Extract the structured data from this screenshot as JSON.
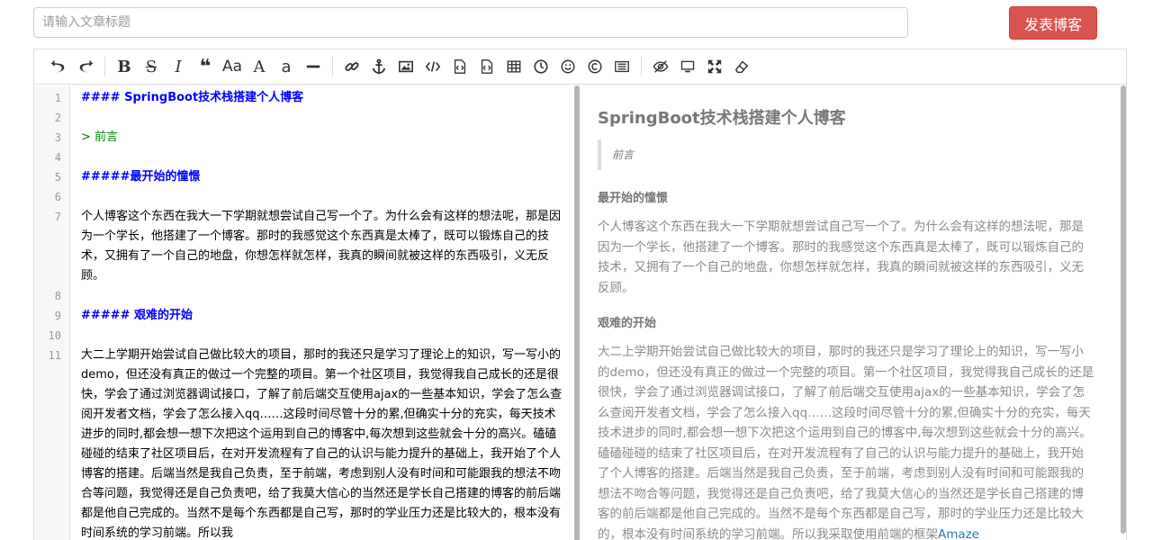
{
  "header": {
    "title_placeholder": "请输入文章标题",
    "publish_label": "发表博客",
    "publish_color": "#d9534f"
  },
  "toolbar": {
    "icons": [
      "undo-icon",
      "redo-icon",
      "bold-icon",
      "strikethrough-icon",
      "italic-icon",
      "quote-icon",
      "uppercase-icon",
      "font-size-large-icon",
      "font-size-small-icon",
      "horizontal-rule-icon",
      "link-icon",
      "anchor-icon",
      "image-icon",
      "code-icon",
      "code-block-icon",
      "preformatted-icon",
      "table-icon",
      "datetime-icon",
      "emoji-icon",
      "html-entities-icon",
      "pagebreak-icon",
      "toggle-preview-icon",
      "watch-icon",
      "fullscreen-icon",
      "clear-icon"
    ]
  },
  "code": {
    "lines": [
      {
        "n": "1",
        "text": "#### SpringBoot技术栈搭建个人博客"
      },
      {
        "n": "2",
        "text": ""
      },
      {
        "n": "3",
        "text": "> 前言"
      },
      {
        "n": "4",
        "text": ""
      },
      {
        "n": "5",
        "text": "#####最开始的憧憬"
      },
      {
        "n": "6",
        "text": ""
      },
      {
        "n": "7",
        "text": "个人博客这个东西在我大一下学期就想尝试自己写一个了。为什么会有这样的想法呢，那是因为一个学长，他搭建了一个博客。那时的我感觉这个东西真是太棒了，既可以锻炼自己的技术，又拥有了一个自己的地盘，你想怎样就怎样，我真的瞬间就被这样的东西吸引，义无反顾。"
      },
      {
        "n": "8",
        "text": ""
      },
      {
        "n": "9",
        "text": "##### 艰难的开始"
      },
      {
        "n": "10",
        "text": ""
      },
      {
        "n": "11",
        "text": "大二上学期开始尝试自己做比较大的项目，那时的我还只是学习了理论上的知识，写一写小的demo，但还没有真正的做过一个完整的项目。第一个社区项目，我觉得我自己成长的还是很快，学会了通过浏览器调试接口，了解了前后端交互使用ajax的一些基本知识，学会了怎么查阅开发者文档，学会了怎么接入qq……这段时间尽管十分的累,但确实十分的充实，每天技术进步的同时,都会想一想下次把这个运用到自己的博客中,每次想到这些就会十分的高兴。磕磕碰碰的结束了社区项目后，在对开发流程有了自己的认识与能力提升的基础上，我开始了个人博客的搭建。后端当然是我自己负责，至于前端，考虑到别人没有时间和可能跟我的想法不吻合等问题，我觉得还是自己负责吧，给了我莫大信心的当然还是学长自己搭建的博客的前后端都是他自己完成的。当然不是每个东西都是自己写，那时的学业压力还是比较大的，根本没有时间系统的学习前端。所以我"
      }
    ]
  },
  "preview": {
    "title": "SpringBoot技术栈搭建个人博客",
    "quote": "前言",
    "h1": "最开始的憧憬",
    "p1": "个人博客这个东西在我大一下学期就想尝试自己写一个了。为什么会有这样的想法呢，那是因为一个学长，他搭建了一个博客。那时的我感觉这个东西真是太棒了，既可以锻炼自己的技术，又拥有了一个自己的地盘，你想怎样就怎样，我真的瞬间就被这样的东西吸引，义无反顾。",
    "h2": "艰难的开始",
    "p2": "大二上学期开始尝试自己做比较大的项目，那时的我还只是学习了理论上的知识，写一写小的demo，但还没有真正的做过一个完整的项目。第一个社区项目，我觉得我自己成长的还是很快，学会了通过浏览器调试接口，了解了前后端交互使用ajax的一些基本知识，学会了怎么查阅开发者文档，学会了怎么接入qq……这段时间尽管十分的累,但确实十分的充实，每天技术进步的同时,都会想一想下次把这个运用到自己的博客中,每次想到这些就会十分的高兴。磕磕碰碰的结束了社区项目后，在对开发流程有了自己的认识与能力提升的基础上，我开始了个人博客的搭建。后端当然是我自己负责，至于前端，考虑到别人没有时间和可能跟我的想法不吻合等问题，我觉得还是自己负责吧，给了我莫大信心的当然还是学长自己搭建的博客的前后端都是他自己完成的。当然不是每个东西都是自己写，那时的学业压力还是比较大的，根本没有时间系统的学习前端。所以我采取使用前端的框架",
    "p2_link": "Amaze"
  }
}
